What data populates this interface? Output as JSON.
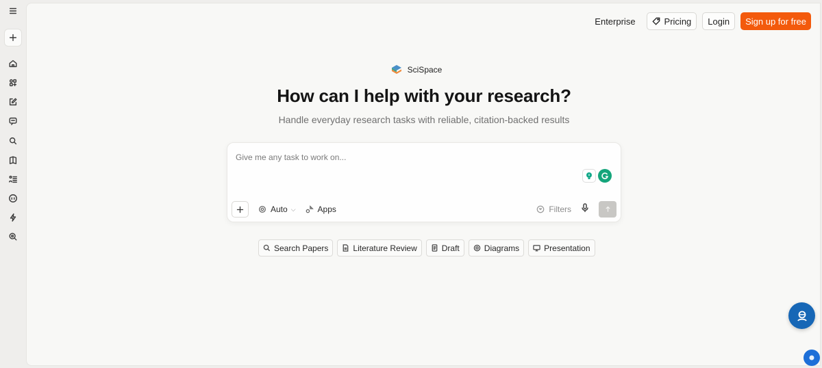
{
  "sidebar": {
    "icons": [
      "menu-icon",
      "new-chat-icon",
      "home-icon",
      "apps-grid-icon",
      "edit-icon",
      "chat-icon",
      "search-icon",
      "library-icon",
      "list-icon",
      "quote-icon",
      "lightning-icon",
      "zoom-search-icon"
    ]
  },
  "nav": {
    "enterprise": "Enterprise",
    "pricing": "Pricing",
    "login": "Login",
    "signup": "Sign up for free"
  },
  "brand": {
    "name": "SciSpace"
  },
  "hero": {
    "title": "How can I help with your research?",
    "subtitle": "Handle everyday research tasks with reliable, citation-backed results"
  },
  "prompt": {
    "placeholder": "Give me any task to work on...",
    "mode_label": "Auto",
    "apps_label": "Apps",
    "filters_label": "Filters"
  },
  "chips": [
    {
      "label": "Search Papers",
      "icon": "search-icon"
    },
    {
      "label": "Literature Review",
      "icon": "document-icon"
    },
    {
      "label": "Draft",
      "icon": "file-icon"
    },
    {
      "label": "Diagrams",
      "icon": "diagram-icon"
    },
    {
      "label": "Presentation",
      "icon": "monitor-icon"
    }
  ],
  "colors": {
    "accent": "#f35a0c",
    "help_fab": "#1767b6",
    "background": "#f8f8f6"
  }
}
